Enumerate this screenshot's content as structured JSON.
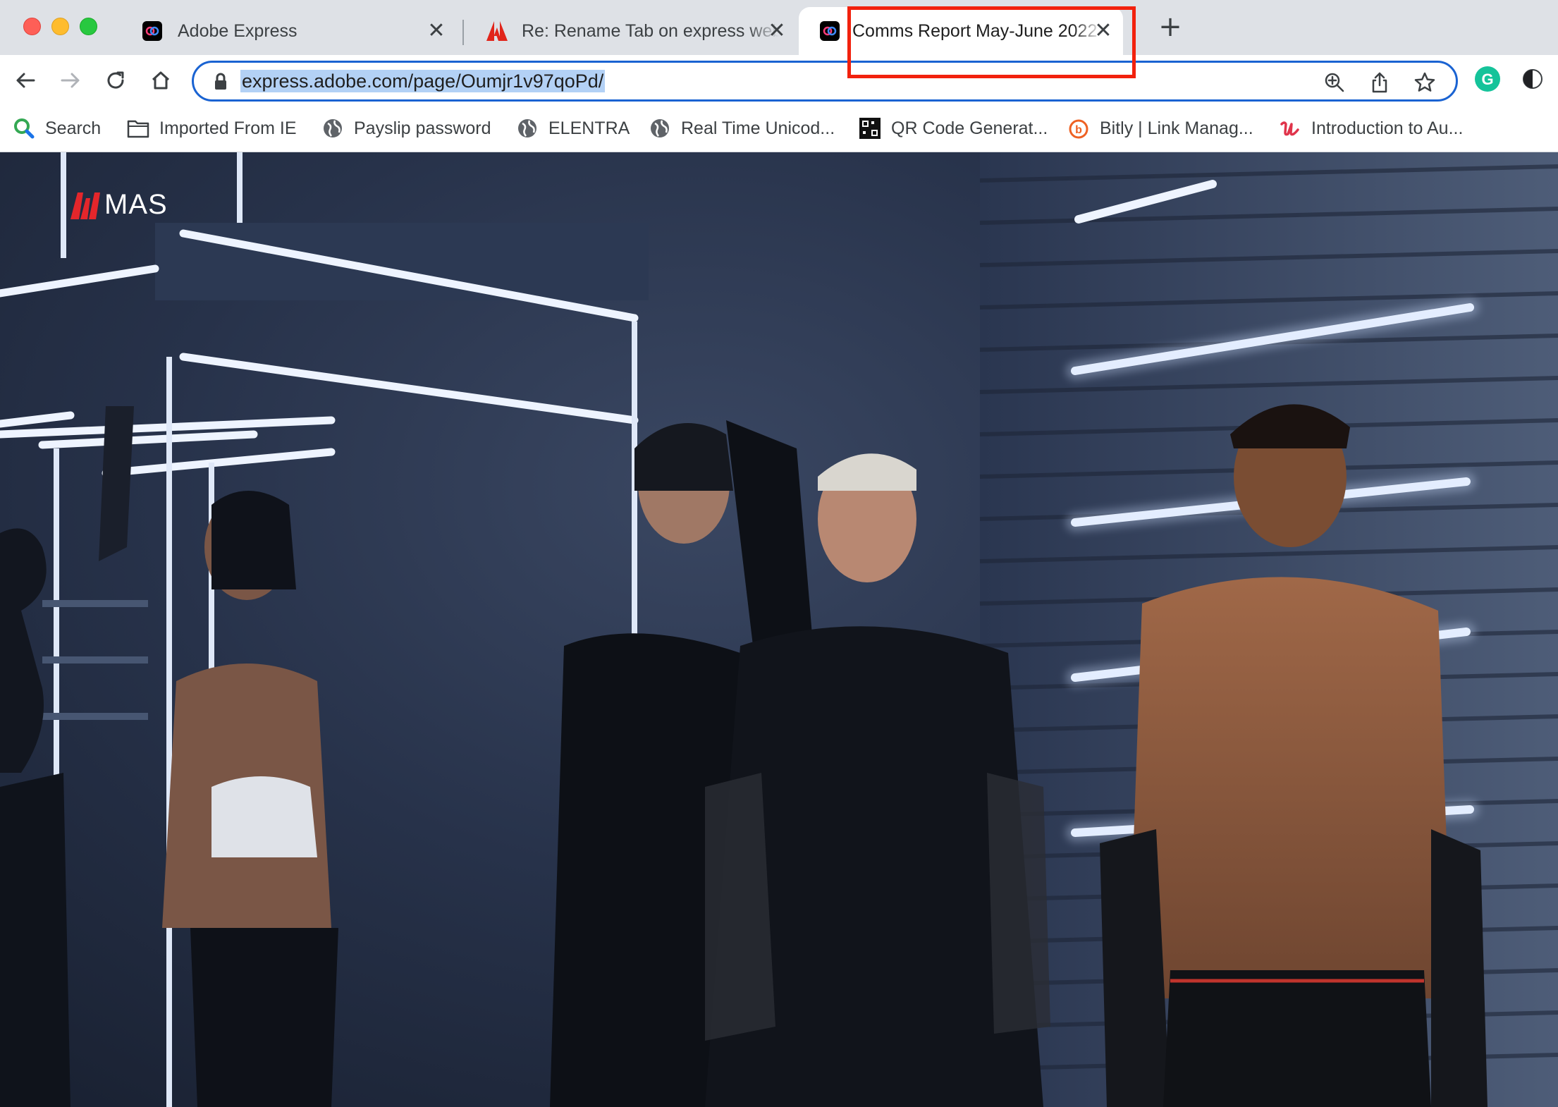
{
  "tabs": [
    {
      "title": "Adobe Express",
      "favicon": "adobe-express-icon",
      "active": false
    },
    {
      "title": "Re: Rename Tab on express web",
      "favicon": "adobe-icon",
      "active": false
    },
    {
      "title": "Comms Report May-June 2022",
      "favicon": "adobe-express-icon",
      "active": true
    }
  ],
  "toolbar": {
    "url": "express.adobe.com/page/Oumjr1v97qoPd/"
  },
  "bookmarks": [
    {
      "label": "Search",
      "icon": "search-icon"
    },
    {
      "label": "Imported From IE",
      "icon": "folder-icon"
    },
    {
      "label": "Payslip password",
      "icon": "globe-icon"
    },
    {
      "label": "ELENTRA",
      "icon": "globe-icon"
    },
    {
      "label": "Real Time Unicod...",
      "icon": "globe-icon"
    },
    {
      "label": "QR Code Generat...",
      "icon": "qr-icon"
    },
    {
      "label": "Bitly | Link Manag...",
      "icon": "bitly-icon"
    },
    {
      "label": "Introduction to Au...",
      "icon": "u-icon"
    }
  ],
  "page": {
    "logo_text": "MAS"
  },
  "colors": {
    "omnibox_border": "#1a63d2",
    "url_selection": "#b3d1f5",
    "highlight": "#f2210d",
    "tabstrip": "#dee1e6"
  }
}
